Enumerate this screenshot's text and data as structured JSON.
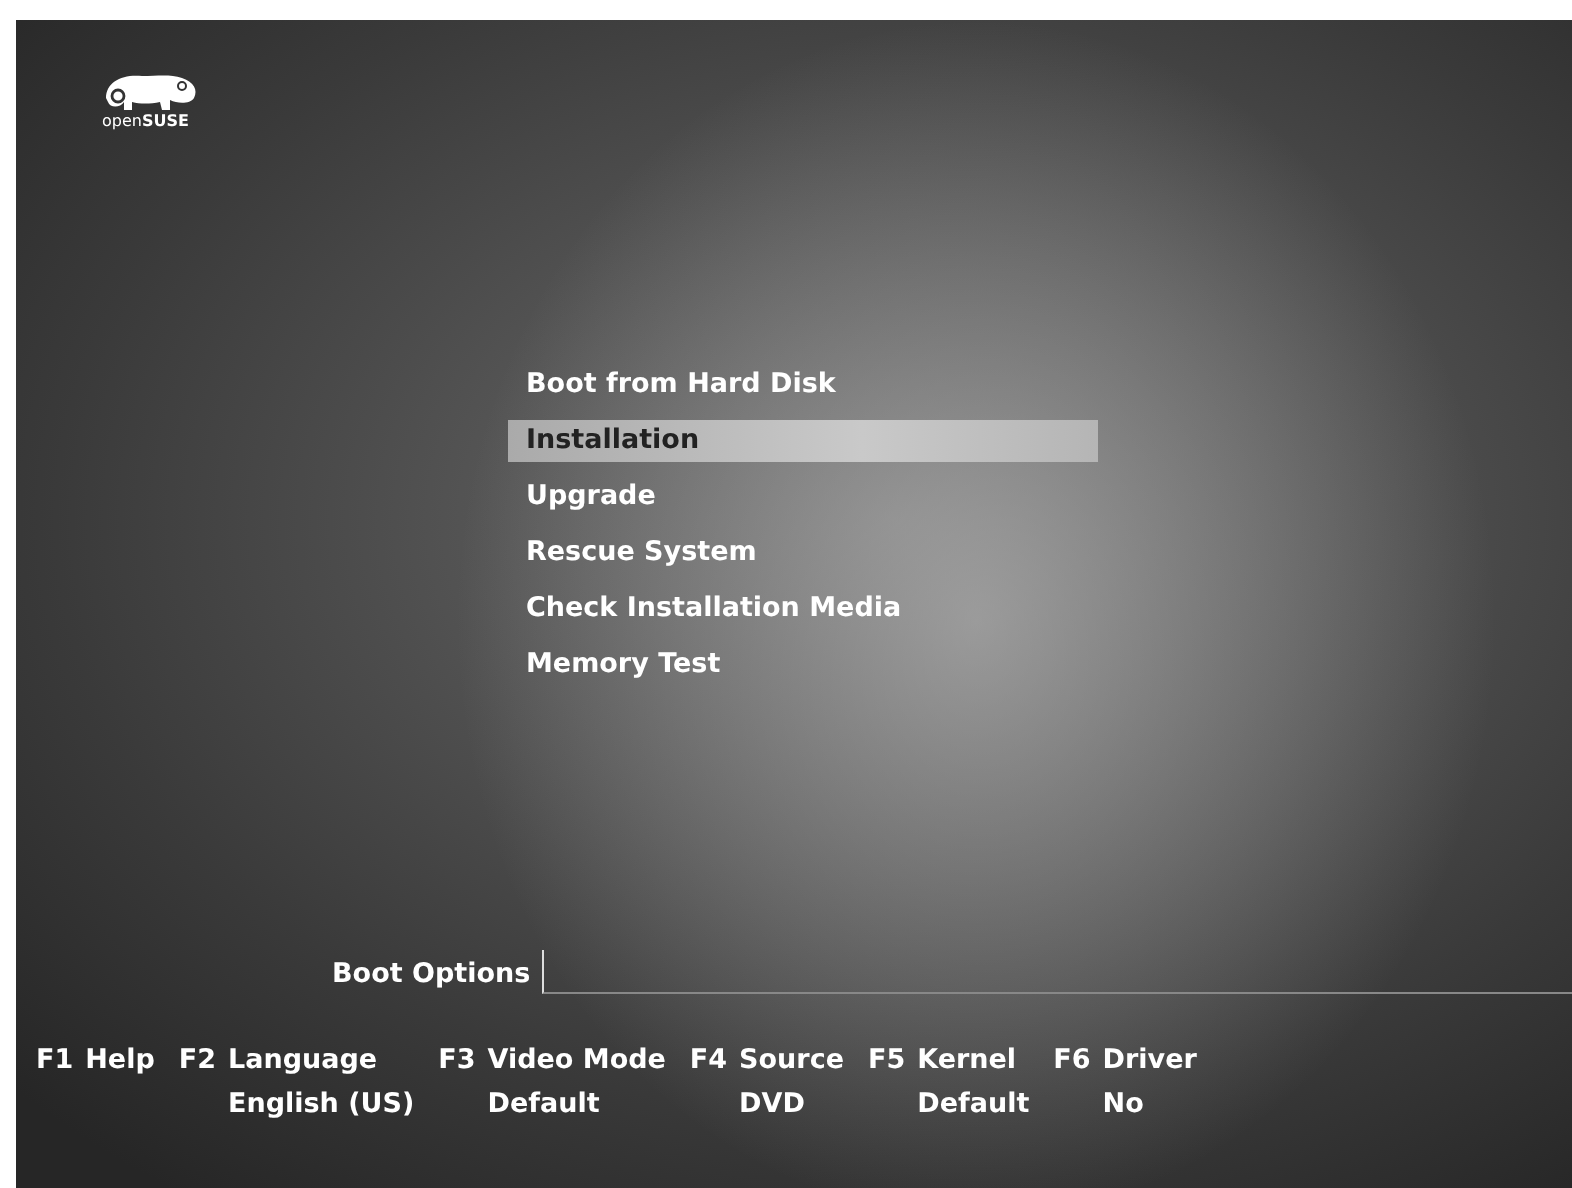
{
  "logo": {
    "text": "open**SUSE**"
  },
  "menu": [
    {
      "label": "Boot from Hard Disk",
      "selected": false
    },
    {
      "label": "Installation",
      "selected": true
    },
    {
      "label": "Upgrade",
      "selected": false
    },
    {
      "label": "Rescue System",
      "selected": false
    },
    {
      "label": "Check Installation Media",
      "selected": false
    },
    {
      "label": "Memory Test",
      "selected": false
    }
  ],
  "boot_options": {
    "label": "Boot Options"
  },
  "function_keys": [
    {
      "key": "F1",
      "label": "Help"
    },
    {
      "key": "F2",
      "label": "Language",
      "value": "English (US)"
    },
    {
      "key": "F3",
      "label": "Video Mode",
      "value": "Default"
    },
    {
      "key": "F4",
      "label": "Source",
      "value": "DVD"
    },
    {
      "key": "F5",
      "label": "Kernel",
      "value": "Default"
    },
    {
      "key": "F6",
      "label": "Driver",
      "value": "No"
    }
  ]
}
